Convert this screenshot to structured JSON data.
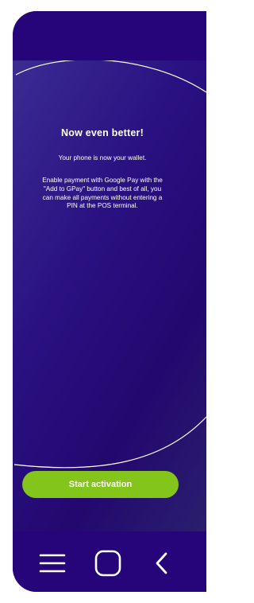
{
  "screen": {
    "title": "Now even better!",
    "subtitle": "Your phone is now your wallet.",
    "description": "Enable payment with Google Pay with the \"Add to GPay\" button and best of all, you can make all payments without entering a PIN at the POS terminal."
  },
  "actions": {
    "start_label": "Start activation"
  },
  "navigation": {
    "buttons": [
      "menu-icon",
      "home-icon",
      "back-icon"
    ]
  },
  "colors": {
    "background": "#260479",
    "accent": "#84c51c",
    "text": "#ffffff"
  }
}
